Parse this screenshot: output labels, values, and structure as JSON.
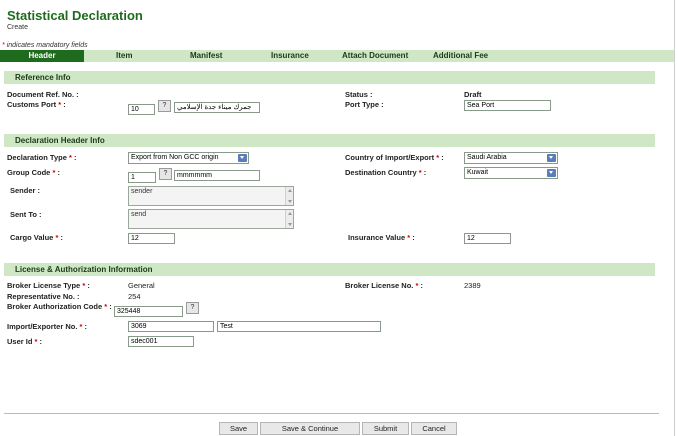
{
  "page": {
    "title": "Statistical Declaration",
    "subtitle": "Create",
    "mandatory_note": "indicates mandatory fields"
  },
  "tabs": [
    "Header",
    "Item",
    "Manifest",
    "Insurance",
    "Attach Document",
    "Additional Fee"
  ],
  "reference": {
    "section_title": "Reference Info",
    "doc_ref_label": "Document Ref. No. :",
    "customs_port_label": "Customs Port",
    "customs_port_code": "10",
    "customs_port_name": "جمرك ميناء جدة الإسلامي",
    "status_label": "Status :",
    "status_value": "Draft",
    "port_type_label": "Port Type :",
    "port_type_value": "Sea Port"
  },
  "header_info": {
    "section_title": "Declaration Header Info",
    "decl_type_label": "Declaration Type",
    "decl_type_value": "Export from Non GCC origin",
    "country_label": "Country of Import/Export",
    "country_value": "Saudi Arabia",
    "group_code_label": "Group Code",
    "group_code_value": "1",
    "group_code_name": "mmmmmm",
    "dest_country_label": "Destination Country",
    "dest_country_value": "Kuwait",
    "sender_label": "Sender :",
    "sender_value": "sender",
    "sent_to_label": "Sent To :",
    "sent_to_value": "send",
    "cargo_value_label": "Cargo Value",
    "cargo_value": "12",
    "insurance_value_label": "Insurance Value",
    "insurance_value": "12"
  },
  "license": {
    "section_title": "License & Authorization Information",
    "broker_license_type_label": "Broker License Type",
    "broker_license_type_value": "General",
    "broker_license_no_label": "Broker License No.",
    "broker_license_no_value": "2389",
    "rep_no_label": "Representative No. :",
    "rep_no_value": "254",
    "broker_auth_label": "Broker Authorization Code",
    "broker_auth_value": "325448",
    "importer_label": "Import/Exporter No.",
    "importer_code": "3069",
    "importer_name": "Test",
    "user_id_label": "User Id",
    "user_id_value": "sdec001"
  },
  "buttons": {
    "save": "Save",
    "save_continue": "Save & Continue",
    "submit": "Submit",
    "cancel": "Cancel"
  },
  "icons": {
    "lookup": "?"
  },
  "colors": {
    "accent": "#1e6b1e",
    "section_bg": "#cfe7c4",
    "required": "#cc0000"
  }
}
